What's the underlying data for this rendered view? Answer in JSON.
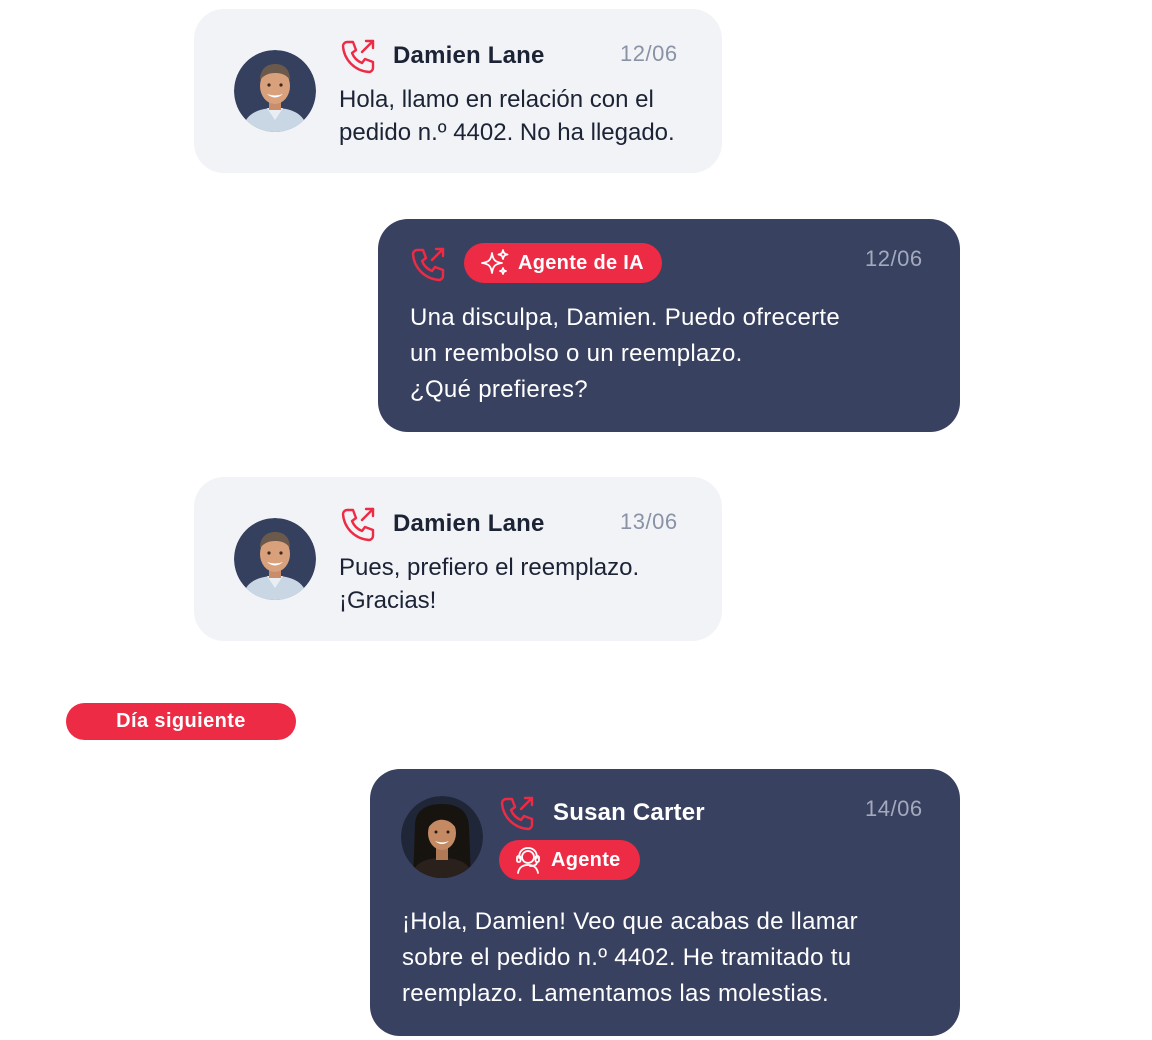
{
  "colors": {
    "accent": "#ee2b45",
    "dark_bubble": "#394160",
    "light_bubble": "#f1f3f7",
    "date_text": "#8a92a6"
  },
  "messages": [
    {
      "sender": "Damien Lane",
      "date": "12/06",
      "text": "Hola, llamo en relación con el\npedido n.º 4402. No ha llegado.",
      "channel_icon": "phone-outgoing-icon",
      "avatar": "customer-avatar"
    },
    {
      "badge": "Agente de IA",
      "badge_icon": "sparkles-icon",
      "date": "12/06",
      "text": "Una disculpa, Damien. Puedo ofrecerte\nun reembolso o un reemplazo.\n¿Qué prefieres?",
      "channel_icon": "phone-outgoing-icon"
    },
    {
      "sender": "Damien Lane",
      "date": "13/06",
      "text": "Pues, prefiero el reemplazo.\n¡Gracias!",
      "channel_icon": "phone-outgoing-icon",
      "avatar": "customer-avatar"
    },
    {
      "sender": "Susan Carter",
      "badge": "Agente",
      "badge_icon": "agent-headset-icon",
      "date": "14/06",
      "text": "¡Hola, Damien! Veo que acabas de llamar\nsobre el pedido n.º 4402. He tramitado tu\nreemplazo. Lamentamos las molestias.",
      "channel_icon": "phone-outgoing-icon",
      "avatar": "agent-avatar"
    }
  ],
  "divider": {
    "label": "Día siguiente"
  }
}
